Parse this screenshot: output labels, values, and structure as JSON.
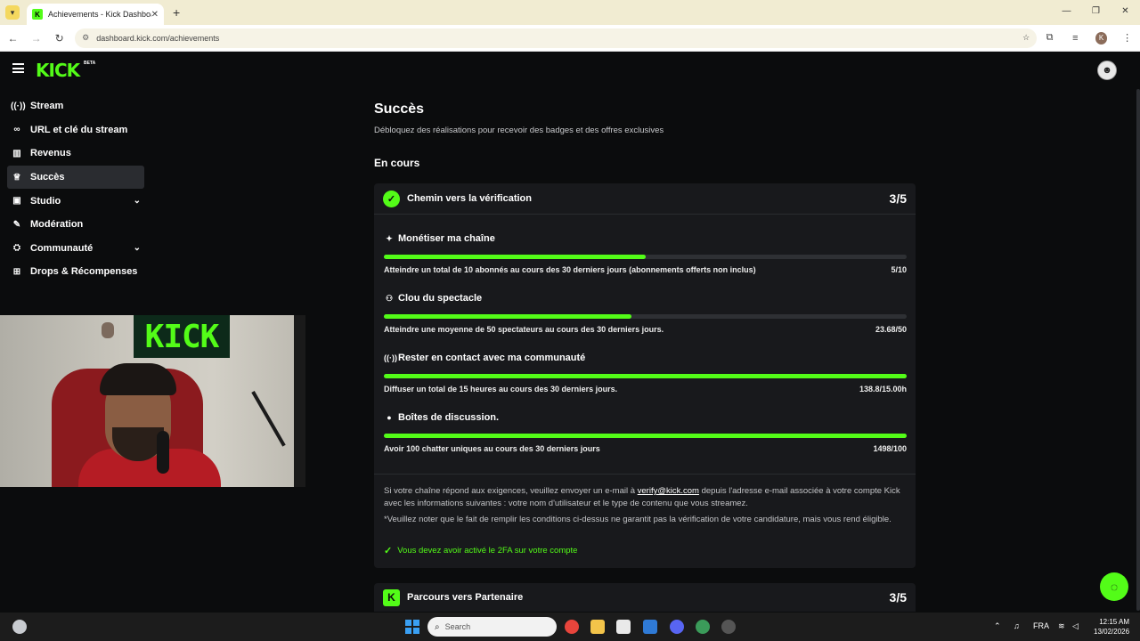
{
  "browser": {
    "tab_title": "Achievements - Kick Dashboard",
    "tab_close": "✕",
    "new_tab": "+",
    "url": "dashboard.kick.com/achievements",
    "window_controls": [
      "—",
      "❐",
      "✕"
    ],
    "profile_initial": "K"
  },
  "header": {
    "logo": "KICK",
    "beta": "BETA"
  },
  "sidebar": {
    "items": [
      {
        "label": "Stream",
        "icon": "broadcast-icon"
      },
      {
        "label": "URL et clé du stream",
        "icon": "link-icon"
      },
      {
        "label": "Revenus",
        "icon": "chart-icon"
      },
      {
        "label": "Succès",
        "icon": "trophy-icon",
        "active": true
      },
      {
        "label": "Studio",
        "icon": "studio-icon",
        "expandable": true
      },
      {
        "label": "Modération",
        "icon": "wrench-icon"
      },
      {
        "label": "Communauté",
        "icon": "community-icon",
        "expandable": true
      },
      {
        "label": "Drops & Récompenses",
        "icon": "gift-icon"
      }
    ]
  },
  "webcam": {
    "sign_text": "KICK"
  },
  "main": {
    "title": "Succès",
    "subtitle": "Débloquez des réalisations pour recevoir des badges et des offres exclusives",
    "section": "En cours",
    "card": {
      "title": "Chemin vers la vérification",
      "count": "3/5",
      "tasks": [
        {
          "name": "Monétiser ma chaîne",
          "desc": "Atteindre un total de 10 abonnés au cours des 30 derniers jours (abonnements offerts non inclus)",
          "value": "5/10",
          "progress": 0.5
        },
        {
          "name": "Clou du spectacle",
          "desc": "Atteindre une moyenne de 50 spectateurs au cours des 30 derniers jours.",
          "value": "23.68/50",
          "progress": 0.4736
        },
        {
          "name": "Rester en contact avec ma communauté",
          "desc": "Diffuser un total de 15 heures au cours des 30 derniers jours.",
          "value": "138.8/15.00h",
          "progress": 1.0
        },
        {
          "name": "Boîtes de discussion.",
          "desc": "Avoir 100 chatter uniques au cours des 30 derniers jours",
          "value": "1498/100",
          "progress": 1.0
        }
      ],
      "info1_pre": "Si votre chaîne répond aux exigences, veuillez envoyer un e-mail à",
      "info1_link": "verify@kick.com",
      "info1_post": "depuis l'adresse e-mail associée à votre compte Kick avec les informations suivantes : votre nom d'utilisateur et le type de contenu que vous streamez.",
      "info2": "*Veuillez noter que le fait de remplir les conditions ci-dessus ne garantit pas la vérification de votre candidature, mais vous rend éligible.",
      "requirement": "Vous devez avoir activé le 2FA sur votre compte"
    },
    "card2": {
      "title": "Parcours vers Partenaire",
      "count": "3/5"
    }
  },
  "taskbar": {
    "search_placeholder": "Search",
    "lang": "FRA",
    "time": "12:15 AM",
    "date": "13/02/2026"
  },
  "colors": {
    "accent": "#53fc18",
    "background": "#0b0c0d",
    "card": "#18191c"
  }
}
